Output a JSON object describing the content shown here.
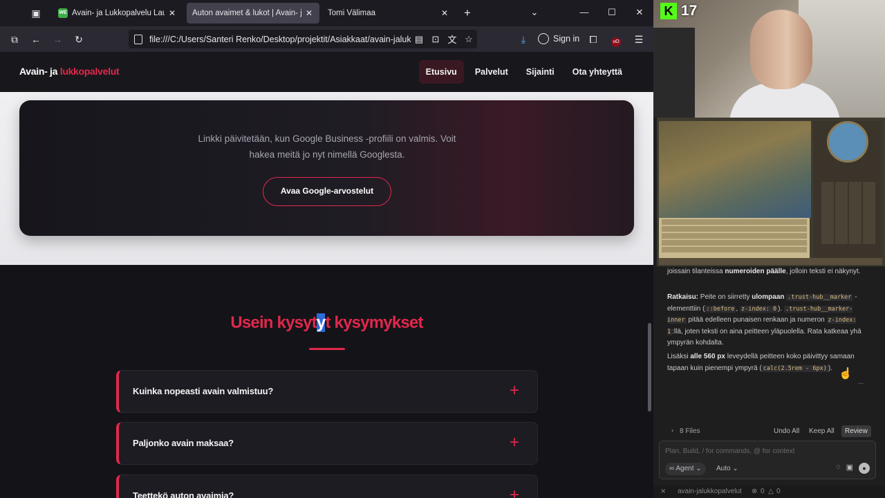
{
  "browser": {
    "tabs": [
      {
        "favicon": "WE",
        "title": "Avain- ja Lukkopalvelu Laune O",
        "active": false
      },
      {
        "title": "Auton avaimet & lukot | Avain- ja lu",
        "active": true
      },
      {
        "title": "Tomi Välimaa",
        "active": false
      }
    ],
    "url": "file:///C:/Users/Santeri Renko/Desktop/projektit/Asiakkaat/avain-jaluk",
    "signin_label": "Sign in"
  },
  "site": {
    "brand_prefix": "Avain- ja ",
    "brand_accent": "lukkopalvelut",
    "nav": [
      "Etusivu",
      "Palvelut",
      "Sijainti",
      "Ota yhteyttä"
    ],
    "review_text": "Linkki päivitetään, kun Google Business -profiili on valmis. Voit hakea meitä jo nyt nimellä Googlesta.",
    "review_button": "Avaa Google-arvostelut",
    "faq_title_before": "Usein kysyt",
    "faq_title_selected": "y",
    "faq_title_after": "t kysymykset",
    "faq": [
      {
        "question": "Kuinka nopeasti avain valmistuu?"
      },
      {
        "question": "Paljonko avain maksaa?"
      },
      {
        "question": "Teettekö auton avaimia?"
      }
    ],
    "colors": {
      "accent": "#e1284c",
      "dark": "#141318"
    }
  },
  "stream": {
    "kick_logo": "K",
    "viewer_count": "17"
  },
  "agent_chat": {
    "p1_text": "joissain tilanteissa ",
    "p1_bold": "numeroiden päälle",
    "p1_text2": ", jolloin teksti ei näkynyt.",
    "p2_bold": "Ratkaisu:",
    "p2_text1": " Peite on siirretty ",
    "p2_bold2": "ulompaan",
    "p2_code1": ".trust-hub__marker",
    "p2_text2": " -elementtiin (",
    "p2_code2": "::before",
    "p2_text3": ", ",
    "p2_code3": "z-index: 0",
    "p2_text4": "). ",
    "p2_code4": ".trust-hub__marker-inner",
    "p2_text5": " pitää edelleen punaisen renkaan ja numeron ",
    "p2_code5": "z-index: 1",
    "p2_text6": ":llä, joten teksti on aina peitteen yläpuolella. Rata katkeaa yhä ympyrän kohdalta.",
    "p3_text1": "Lisäksi ",
    "p3_bold": "alle 560 px",
    "p3_text2": " leveydellä peitteen koko päivittyy samaan tapaan kuin pienempi ympyrä (",
    "p3_code": "calc(2.5rem - 6px)",
    "p3_text3": ").",
    "ellipsis": "...",
    "files_label": "8 Files",
    "undo_all": "Undo All",
    "keep_all": "Keep All",
    "review": "Review",
    "input_placeholder": "Plan, Build, / for commands, @ for context",
    "agent_mode": "Agent",
    "model": "Auto",
    "status_project": "avain-jalukkopalvelut",
    "status_errors": "0",
    "status_warnings": "0"
  }
}
